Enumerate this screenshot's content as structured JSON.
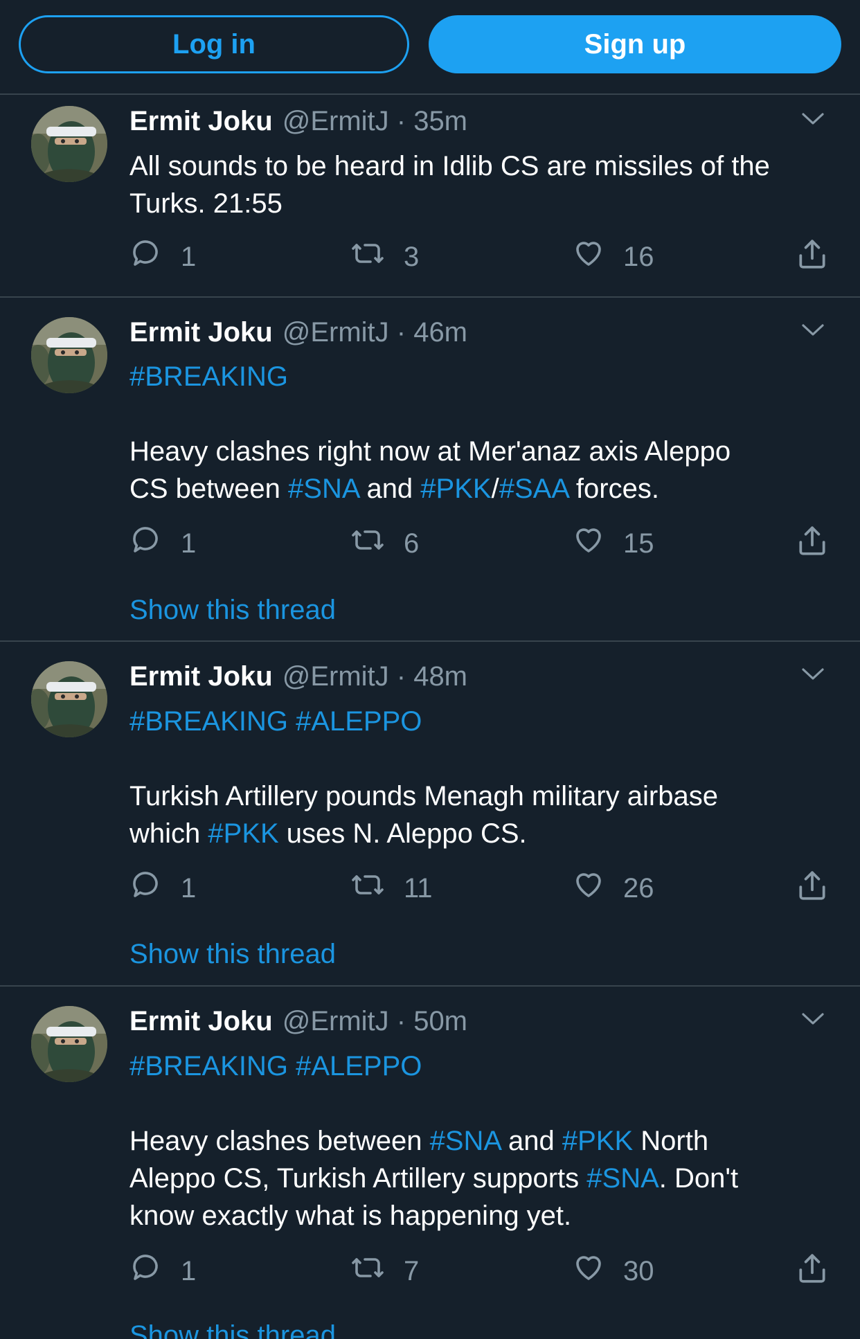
{
  "topbar": {
    "login_label": "Log in",
    "signup_label": "Sign up"
  },
  "tweets": [
    {
      "name": "Ermit Joku",
      "meta": "@ErmitJ · 35m",
      "lines": [
        [
          {
            "t": "All sounds to be heard in Idlib CS are missiles of the",
            "tag": false
          }
        ],
        [
          {
            "t": "Turks. 21:55",
            "tag": false
          }
        ]
      ],
      "replies": "1",
      "retweets": "3",
      "likes": "16",
      "show_thread": ""
    },
    {
      "name": "Ermit Joku",
      "meta": "@ErmitJ · 46m",
      "lines": [
        [
          {
            "t": "#BREAKING",
            "tag": true
          }
        ],
        [],
        [
          {
            "t": "Heavy clashes right now at Mer'anaz axis Aleppo",
            "tag": false
          }
        ],
        [
          {
            "t": "CS between ",
            "tag": false
          },
          {
            "t": "#SNA",
            "tag": true
          },
          {
            "t": " and ",
            "tag": false
          },
          {
            "t": "#PKK",
            "tag": true
          },
          {
            "t": "/",
            "tag": false
          },
          {
            "t": "#SAA",
            "tag": true
          },
          {
            "t": " forces.",
            "tag": false
          }
        ]
      ],
      "replies": "1",
      "retweets": "6",
      "likes": "15",
      "show_thread": "Show this thread"
    },
    {
      "name": "Ermit Joku",
      "meta": "@ErmitJ · 48m",
      "lines": [
        [
          {
            "t": "#BREAKING #ALEPPO",
            "tag": true
          }
        ],
        [],
        [
          {
            "t": "Turkish Artillery pounds Menagh military airbase",
            "tag": false
          }
        ],
        [
          {
            "t": "which ",
            "tag": false
          },
          {
            "t": "#PKK",
            "tag": true
          },
          {
            "t": " uses N. Aleppo CS.",
            "tag": false
          }
        ]
      ],
      "replies": "1",
      "retweets": "11",
      "likes": "26",
      "show_thread": "Show this thread"
    },
    {
      "name": "Ermit Joku",
      "meta": "@ErmitJ · 50m",
      "lines": [
        [
          {
            "t": "#BREAKING #ALEPPO",
            "tag": true
          }
        ],
        [],
        [
          {
            "t": "Heavy clashes between ",
            "tag": false
          },
          {
            "t": "#SNA",
            "tag": true
          },
          {
            "t": " and ",
            "tag": false
          },
          {
            "t": "#PKK",
            "tag": true
          },
          {
            "t": " North",
            "tag": false
          }
        ],
        [
          {
            "t": "Aleppo CS, Turkish Artillery supports ",
            "tag": false
          },
          {
            "t": "#SNA",
            "tag": true
          },
          {
            "t": ". Don't",
            "tag": false
          }
        ],
        [
          {
            "t": "know exactly what is happening yet.",
            "tag": false
          }
        ]
      ],
      "replies": "1",
      "retweets": "7",
      "likes": "30",
      "show_thread": "Show this thread"
    }
  ],
  "colors": {
    "background": "#15202b",
    "accent": "#1da1f2",
    "link": "#1b95e0",
    "muted": "#8899a6",
    "divider": "#38444d"
  },
  "icons": {
    "reply": "reply-icon",
    "retweet": "retweet-icon",
    "like": "heart-icon",
    "share": "share-icon",
    "more": "chevron-down-icon"
  }
}
